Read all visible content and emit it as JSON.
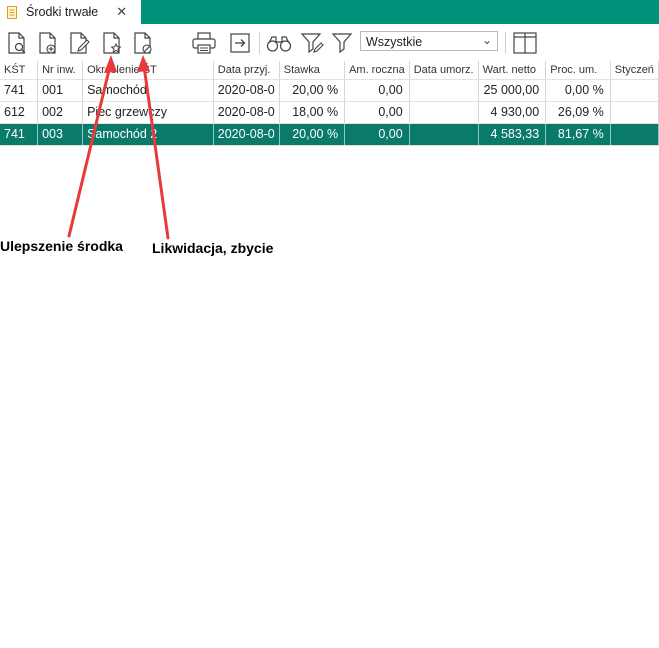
{
  "tab": {
    "title": "Środki trwałe",
    "close": "✕"
  },
  "toolbar": {
    "filter_value": "Wszystkie",
    "buttons": [
      "preview-document",
      "add-document",
      "edit-document",
      "improve-asset",
      "liquidate-asset",
      "print",
      "export",
      "search",
      "filter-advanced",
      "filter",
      "columns"
    ]
  },
  "table": {
    "columns": [
      "KŚT",
      "Nr inw.",
      "Określenie ŚT",
      "Data przyj.",
      "Stawka",
      "Am. roczna",
      "Data umorz.",
      "Wart. netto",
      "Proc. um.",
      "Styczeń"
    ],
    "rows": [
      [
        "741",
        "001",
        "Samochód",
        "2020-08-0",
        "20,00 %",
        "0,00",
        "",
        "25 000,00",
        "0,00 %",
        ""
      ],
      [
        "612",
        "002",
        "Piec grzewczy",
        "2020-08-0",
        "18,00 %",
        "0,00",
        "",
        "4 930,00",
        "26,09 %",
        ""
      ],
      [
        "741",
        "003",
        "Samochód 2",
        "2020-08-0",
        "20,00 %",
        "0,00",
        "",
        "4 583,33",
        "81,67 %",
        ""
      ]
    ],
    "selected_row": 2
  },
  "annotations": {
    "improve": "Ulepszenie środka",
    "liquidate": "Likwidacja, zbycie",
    "arrow_color": "#e83a3a"
  },
  "colors": {
    "accent": "#00917a",
    "selected_row": "#0a7a6a"
  }
}
